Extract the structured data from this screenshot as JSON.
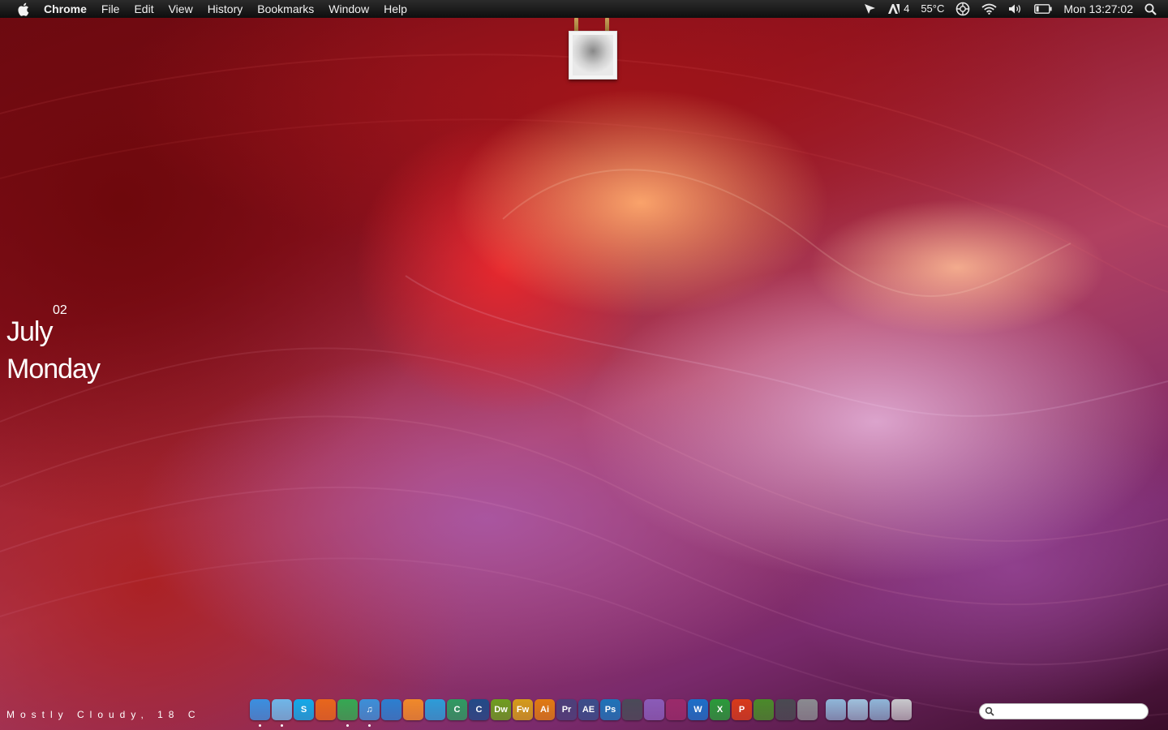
{
  "menubar": {
    "app_name": "Chrome",
    "menus": [
      "File",
      "Edit",
      "View",
      "History",
      "Bookmarks",
      "Window",
      "Help"
    ],
    "status": {
      "adobe_count": "4",
      "temperature": "55°C",
      "clock": "Mon 13:27:02"
    }
  },
  "date_widget": {
    "day_number": "02",
    "month": "July",
    "weekday": "Monday"
  },
  "weather": "Mostly Cloudy, 18 C",
  "dock": {
    "apps": [
      {
        "name": "finder",
        "label": "",
        "color": "#3b8fe0",
        "running": true
      },
      {
        "name": "cursor",
        "label": "",
        "color": "#6fb6e8",
        "running": true
      },
      {
        "name": "skype",
        "label": "S",
        "color": "#12a9e9",
        "running": false
      },
      {
        "name": "firefox",
        "label": "",
        "color": "#e8661c",
        "running": false
      },
      {
        "name": "chrome",
        "label": "",
        "color": "#35a853",
        "running": true
      },
      {
        "name": "itunes",
        "label": "♫",
        "color": "#3c8fd8",
        "running": true
      },
      {
        "name": "safari",
        "label": "",
        "color": "#2c7fd0",
        "running": false
      },
      {
        "name": "vlc",
        "label": "",
        "color": "#f0892a",
        "running": false
      },
      {
        "name": "adium",
        "label": "",
        "color": "#2d9cd8",
        "running": false
      },
      {
        "name": "app-green",
        "label": "C",
        "color": "#2e9a62",
        "running": false
      },
      {
        "name": "cinema4d",
        "label": "C",
        "color": "#224a87",
        "running": false
      },
      {
        "name": "dreamweaver",
        "label": "Dw",
        "color": "#6e9d1f",
        "running": false
      },
      {
        "name": "fireworks",
        "label": "Fw",
        "color": "#d49b1a",
        "running": false
      },
      {
        "name": "illustrator",
        "label": "Ai",
        "color": "#e07a12",
        "running": false
      },
      {
        "name": "premiere",
        "label": "Pr",
        "color": "#4c3f7a",
        "running": false
      },
      {
        "name": "after-effects",
        "label": "AE",
        "color": "#3a4d8a",
        "running": false
      },
      {
        "name": "photoshop",
        "label": "Ps",
        "color": "#1e73b8",
        "running": false
      },
      {
        "name": "final-cut",
        "label": "",
        "color": "#4a4a58",
        "running": false
      },
      {
        "name": "imovie",
        "label": "",
        "color": "#8a5bb8",
        "running": false
      },
      {
        "name": "app-disc",
        "label": "",
        "color": "#9a2a6a",
        "running": false
      },
      {
        "name": "word",
        "label": "W",
        "color": "#1c6fc8",
        "running": false
      },
      {
        "name": "excel",
        "label": "X",
        "color": "#2a9a3a",
        "running": false
      },
      {
        "name": "powerpoint",
        "label": "P",
        "color": "#d83a1a",
        "running": false
      },
      {
        "name": "minecraft",
        "label": "",
        "color": "#4a8a2a",
        "running": false
      },
      {
        "name": "steam",
        "label": "",
        "color": "#4a4a52",
        "running": false
      },
      {
        "name": "system-preferences",
        "label": "",
        "color": "#8a8a90",
        "running": false
      }
    ],
    "stacks": [
      {
        "name": "applications-folder",
        "color": "#8fb6d8"
      },
      {
        "name": "documents-folder",
        "color": "#9ec0dc"
      },
      {
        "name": "downloads-folder",
        "color": "#8fb6d8"
      },
      {
        "name": "trash",
        "color": "#c8c8cc"
      }
    ]
  },
  "search": {
    "value": "",
    "placeholder": ""
  }
}
